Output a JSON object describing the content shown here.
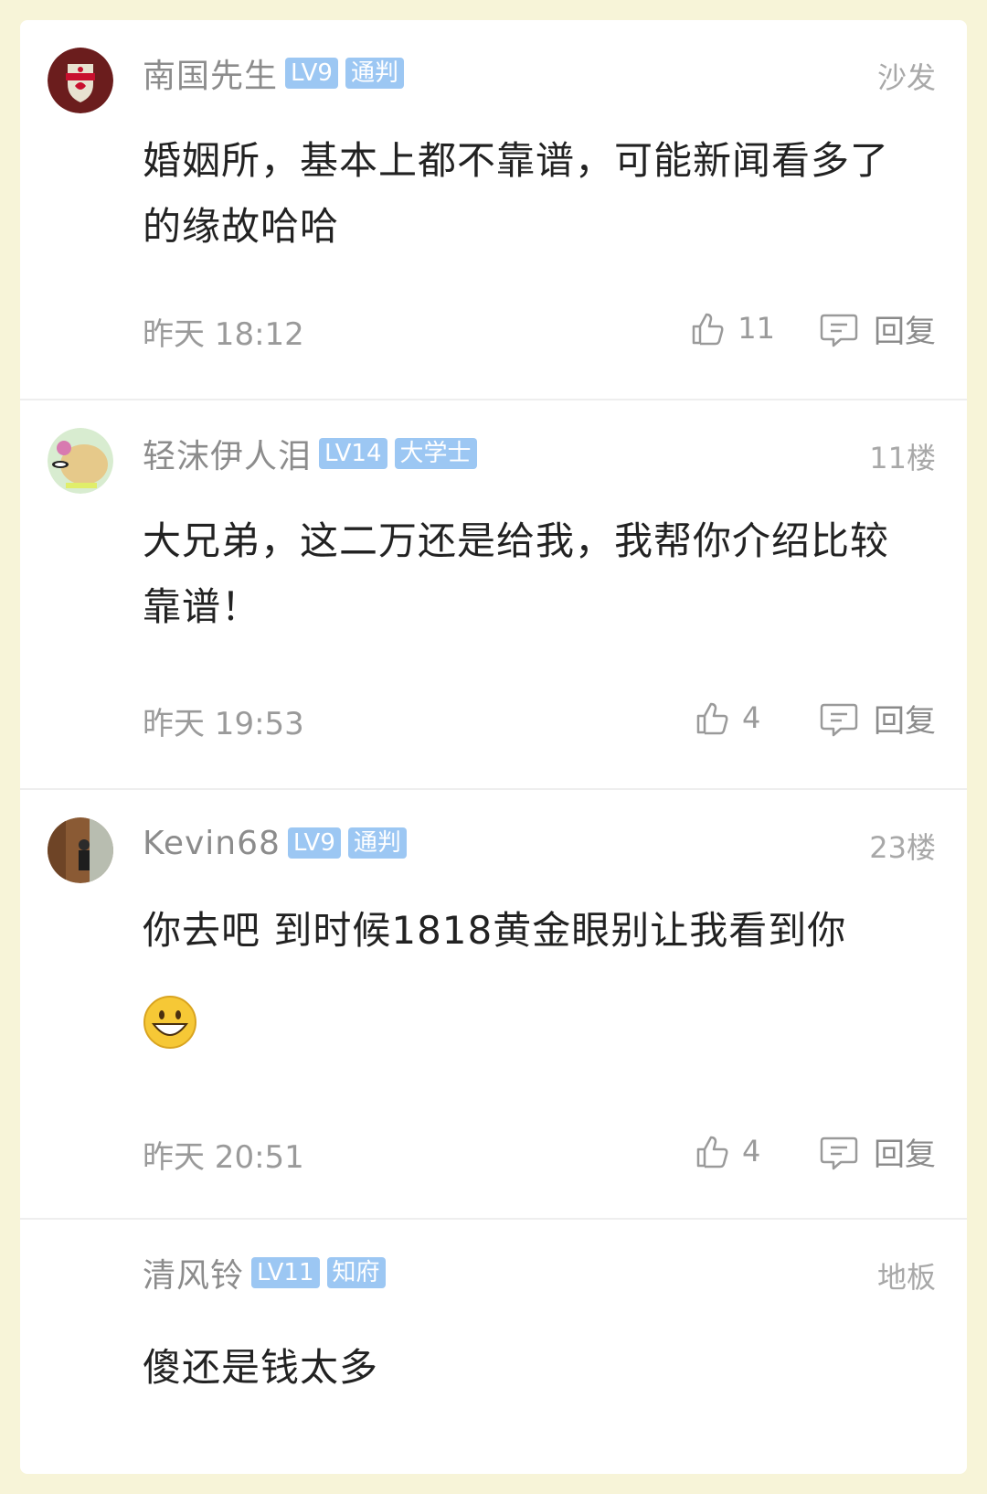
{
  "comments": [
    {
      "username": "南国先生",
      "level": "LV9",
      "title": "通判",
      "floor": "沙发",
      "content": "婚姻所，基本上都不靠谱，可能新闻看多了的缘故哈哈",
      "time": "昨天 18:12",
      "likes": "11",
      "reply_label": "回复",
      "avatar_icon": "liverpool-crest-avatar"
    },
    {
      "username": "轻沫伊人泪",
      "level": "LV14",
      "title": "大学士",
      "floor": "11楼",
      "content": "大兄弟，这二万还是给我，我帮你介绍比较靠谱！",
      "time": "昨天 19:53",
      "likes": "4",
      "reply_label": "回复",
      "avatar_icon": "cartoon-avatar"
    },
    {
      "username": "Kevin68",
      "level": "LV9",
      "title": "通判",
      "floor": "23楼",
      "content": "你去吧 到时候1818黄金眼别让我看到你",
      "emoji": "grinning-face-emoji",
      "time": "昨天 20:51",
      "likes": "4",
      "reply_label": "回复",
      "avatar_icon": "photo-avatar"
    },
    {
      "username": "清风铃",
      "level": "LV11",
      "title": "知府",
      "floor": "地板",
      "content": "傻还是钱太多"
    }
  ]
}
